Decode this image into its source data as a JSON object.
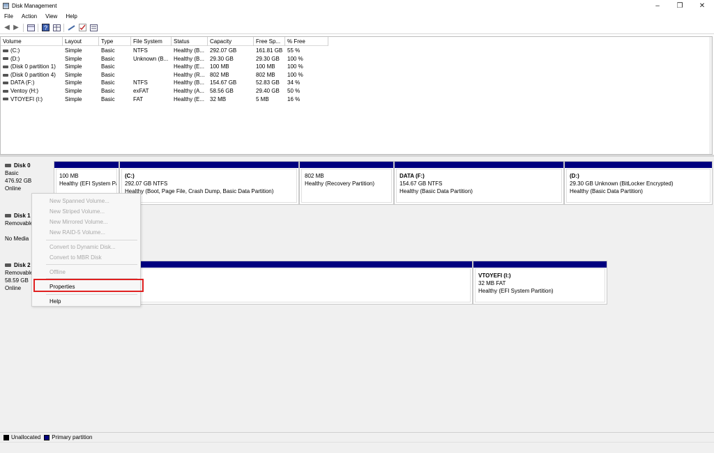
{
  "window": {
    "title": "Disk Management"
  },
  "menu": [
    "File",
    "Action",
    "View",
    "Help"
  ],
  "toolbar_icons": [
    "back-arrow-icon",
    "forward-arrow-icon",
    "console-tree-icon",
    "help-icon",
    "properties-grid-icon",
    "connect-icon",
    "check-icon",
    "list-view-icon"
  ],
  "volume_table": {
    "headers": [
      "Volume",
      "Layout",
      "Type",
      "File System",
      "Status",
      "Capacity",
      "Free Sp...",
      "% Free"
    ],
    "rows": [
      [
        "(C:)",
        "Simple",
        "Basic",
        "NTFS",
        "Healthy (B...",
        "292.07 GB",
        "161.81 GB",
        "55 %"
      ],
      [
        "(D:)",
        "Simple",
        "Basic",
        "Unknown (B...",
        "Healthy (B...",
        "29.30 GB",
        "29.30 GB",
        "100 %"
      ],
      [
        "(Disk 0 partition 1)",
        "Simple",
        "Basic",
        "",
        "Healthy (E...",
        "100 MB",
        "100 MB",
        "100 %"
      ],
      [
        "(Disk 0 partition 4)",
        "Simple",
        "Basic",
        "",
        "Healthy (R...",
        "802 MB",
        "802 MB",
        "100 %"
      ],
      [
        "DATA (F:)",
        "Simple",
        "Basic",
        "NTFS",
        "Healthy (B...",
        "154.67 GB",
        "52.83 GB",
        "34 %"
      ],
      [
        "Ventoy (H:)",
        "Simple",
        "Basic",
        "exFAT",
        "Healthy (A...",
        "58.56 GB",
        "29.40 GB",
        "50 %"
      ],
      [
        "VTOYEFI (I:)",
        "Simple",
        "Basic",
        "FAT",
        "Healthy (E...",
        "32 MB",
        "5 MB",
        "16 %"
      ]
    ]
  },
  "disks": [
    {
      "name": "Disk 0",
      "type": "Basic",
      "size": "476.92 GB",
      "status": "Online",
      "partitions": [
        {
          "name": "",
          "line1": "100 MB",
          "line2": "Healthy (EFI System Pa"
        },
        {
          "name": "(C:)",
          "line1": "292.07 GB NTFS",
          "line2": "Healthy (Boot, Page File, Crash Dump, Basic Data Partition)"
        },
        {
          "name": "",
          "line1": "802 MB",
          "line2": "Healthy (Recovery Partition)"
        },
        {
          "name": "DATA  (F:)",
          "line1": "154.67 GB NTFS",
          "line2": "Healthy (Basic Data Partition)"
        },
        {
          "name": "(D:)",
          "line1": "29.30 GB Unknown (BitLocker Encrypted)",
          "line2": "Healthy (Basic Data Partition)"
        }
      ]
    },
    {
      "name": "Disk 1",
      "type": "Removable",
      "size": "",
      "status": "No Media",
      "partitions": []
    },
    {
      "name": "Disk 2",
      "type": "Removable",
      "size": "58.59 GB",
      "status": "Online",
      "partitions": [
        {
          "name": "",
          "line1": "",
          "line2": ""
        },
        {
          "name": "VTOYEFI  (I:)",
          "line1": "32 MB FAT",
          "line2": "Healthy (EFI System Partition)"
        }
      ]
    }
  ],
  "context_menu": {
    "items": [
      {
        "label": "New Spanned Volume...",
        "enabled": false
      },
      {
        "label": "New Striped Volume...",
        "enabled": false
      },
      {
        "label": "New Mirrored Volume...",
        "enabled": false
      },
      {
        "label": "New RAID-5 Volume...",
        "enabled": false
      },
      {
        "label": "Convert to Dynamic Disk...",
        "enabled": false
      },
      {
        "label": "Convert to MBR Disk",
        "enabled": false
      },
      {
        "label": "Offline",
        "enabled": false
      },
      {
        "label": "Properties",
        "enabled": true
      },
      {
        "label": "Help",
        "enabled": true
      }
    ],
    "highlighted": "Properties",
    "highlight_color": "#e02020"
  },
  "legend": {
    "items": [
      {
        "label": "Unallocated",
        "color": "#000000"
      },
      {
        "label": "Primary partition",
        "color": "#00007f"
      }
    ]
  },
  "colors": {
    "primary_partition_bar": "#00007f"
  }
}
